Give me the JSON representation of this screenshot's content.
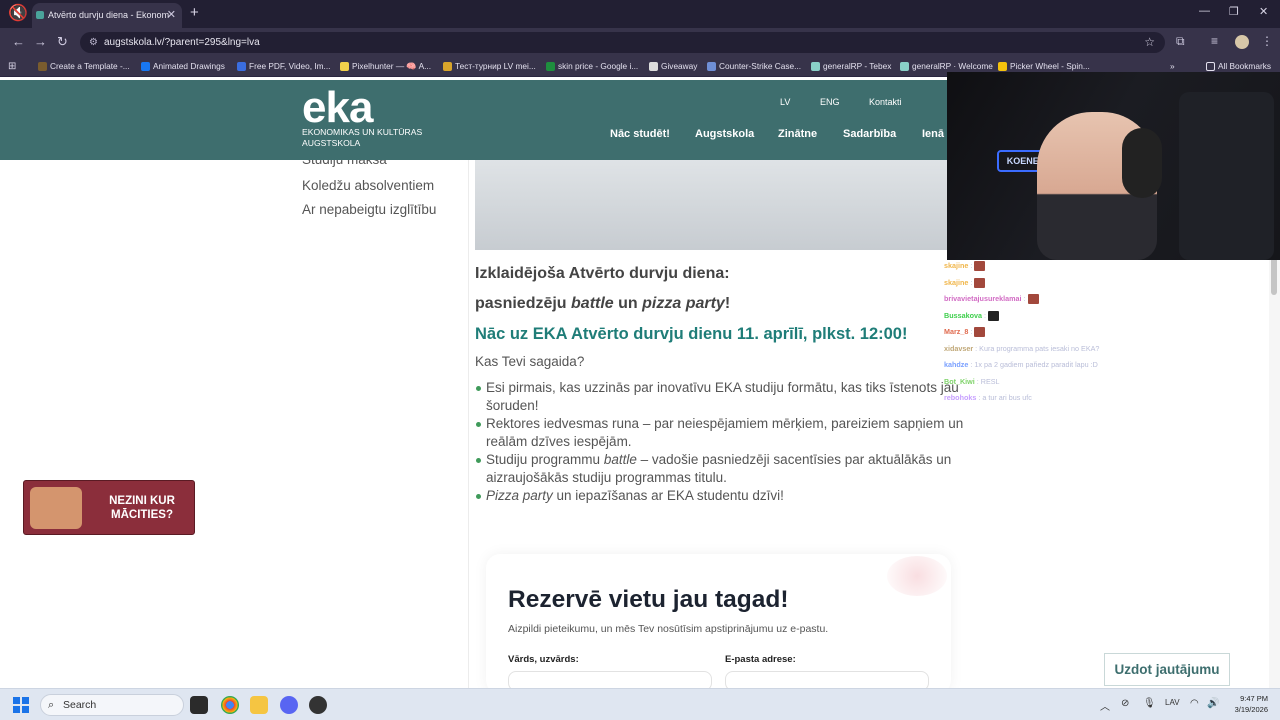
{
  "browser": {
    "tab_title": "Atvērto durvju diena - Ekonom",
    "tab_close": "✕",
    "new_tab": "+",
    "window_controls": [
      "—",
      "❐",
      "✕"
    ],
    "url": "augstskola.lv/?parent=295&lng=lva",
    "bookmarks": [
      {
        "label": "Create a Template -...",
        "color": "#7a5c2e"
      },
      {
        "label": "Animated Drawings",
        "color": "#1877f2"
      },
      {
        "label": "Free PDF, Video, Im...",
        "color": "#3a6de0"
      },
      {
        "label": "Pixelhunter — 🧠 A...",
        "color": "#f2d14b"
      },
      {
        "label": "Тест-турнир LV mei...",
        "color": "#d9a52b"
      },
      {
        "label": "skin price - Google i...",
        "color": "#1e8e3e"
      },
      {
        "label": "Giveaway",
        "color": "#dddddd"
      },
      {
        "label": "Counter-Strike Case...",
        "color": "#6f8fd6"
      },
      {
        "label": "generalRP - Tebex",
        "color": "#8ad0c8"
      },
      {
        "label": "generalRP · Welcome",
        "color": "#8ad0c8"
      },
      {
        "label": "Picker Wheel - Spin...",
        "color": "#f4c20d"
      }
    ],
    "all_bookmarks": "All Bookmarks"
  },
  "site": {
    "logo": "eka",
    "logo_sub": "EKONOMIKAS UN KULTŪRAS AUGSTSKOLA",
    "util_links": [
      "LV",
      "ENG",
      "Kontakti"
    ],
    "nav": [
      "Nāc studēt!",
      "Augstskola",
      "Zinātne",
      "Sadarbība",
      "Ienā"
    ]
  },
  "sidebar": {
    "items": [
      "Studiju maksa",
      "Koledžu absolventiem",
      "Ar nepabeigtu izglītību"
    ]
  },
  "content": {
    "intro_line1": "Izklaidējoša Atvērto durvju diena:",
    "intro_line2_pre": "pasniedzēju ",
    "intro_line2_em1": "battle",
    "intro_line2_mid": " un ",
    "intro_line2_em2": "pizza party",
    "intro_line2_post": "!",
    "teal_heading": "Nāc uz EKA Atvērto durvju dienu 11. aprīlī, plkst. 12:00!",
    "kas": "Kas Tevi sagaida?",
    "bullet1": "Esi pirmais, kas uzzinās par inovatīvu EKA studiju formātu, kas tiks īstenots jau šoruden!",
    "bullet2": "Rektores iedvesmas runa – par neiespējamiem mērķiem, pareiziem sapņiem un reālām dzīves iespējām.",
    "bullet3_pre": "Studiju programmu ",
    "bullet3_em": "battle",
    "bullet3_post": " – vadošie pasniedzēji sacentīsies par aktuālākās un aizraujošākās studiju programmas titulu.",
    "bullet4_em": "Pizza party",
    "bullet4_post": " un iepazīšanas ar EKA studentu dzīvi!"
  },
  "banner": {
    "text": "NEZINI KUR MĀCITIES?"
  },
  "form": {
    "title": "Rezervē vietu jau tagad!",
    "subtitle": "Aizpildi pieteikumu, un mēs Tev nosūtīsim apstiprinājumu uz e-pastu.",
    "name_label": "Vārds, uzvārds:",
    "email_label": "E-pasta adrese:"
  },
  "ask_button": "Uzdot jautājumu",
  "stream": {
    "cam_sign": "KOENER",
    "chat": [
      {
        "user": "skajine",
        "msg": "",
        "color": "#f0b64a",
        "emote": true
      },
      {
        "user": "skajine",
        "msg": "",
        "color": "#f0b64a",
        "emote": true
      },
      {
        "user": "brivavietajusureklamai",
        "msg": "",
        "color": "#d26cc4",
        "emote": true
      },
      {
        "user": "Bussakova",
        "msg": "",
        "color": "#3ecf4c",
        "emote": true
      },
      {
        "user": "Marz_8",
        "msg": "",
        "color": "#e06a4e",
        "emote": true
      },
      {
        "user": "xidavser",
        "msg": "Kura programma pats iesaki no EKA?",
        "color": "#c0a878",
        "emote": false
      },
      {
        "user": "kahdze",
        "msg": "1x pa 2 gadiem pařiedz paradit lapu :D",
        "color": "#7aa0ff",
        "emote": false
      },
      {
        "user": "Bot_Kiwi",
        "msg": "RESL",
        "color": "#7fd36a",
        "emote": false
      },
      {
        "user": "rebohoks",
        "msg": "a tur ari bus ufc",
        "color": "#c7a0ff",
        "emote": false
      }
    ]
  },
  "taskbar": {
    "search": "Search",
    "lang": "LAV",
    "time": "9:47 PM",
    "date": "3/19/2026"
  }
}
